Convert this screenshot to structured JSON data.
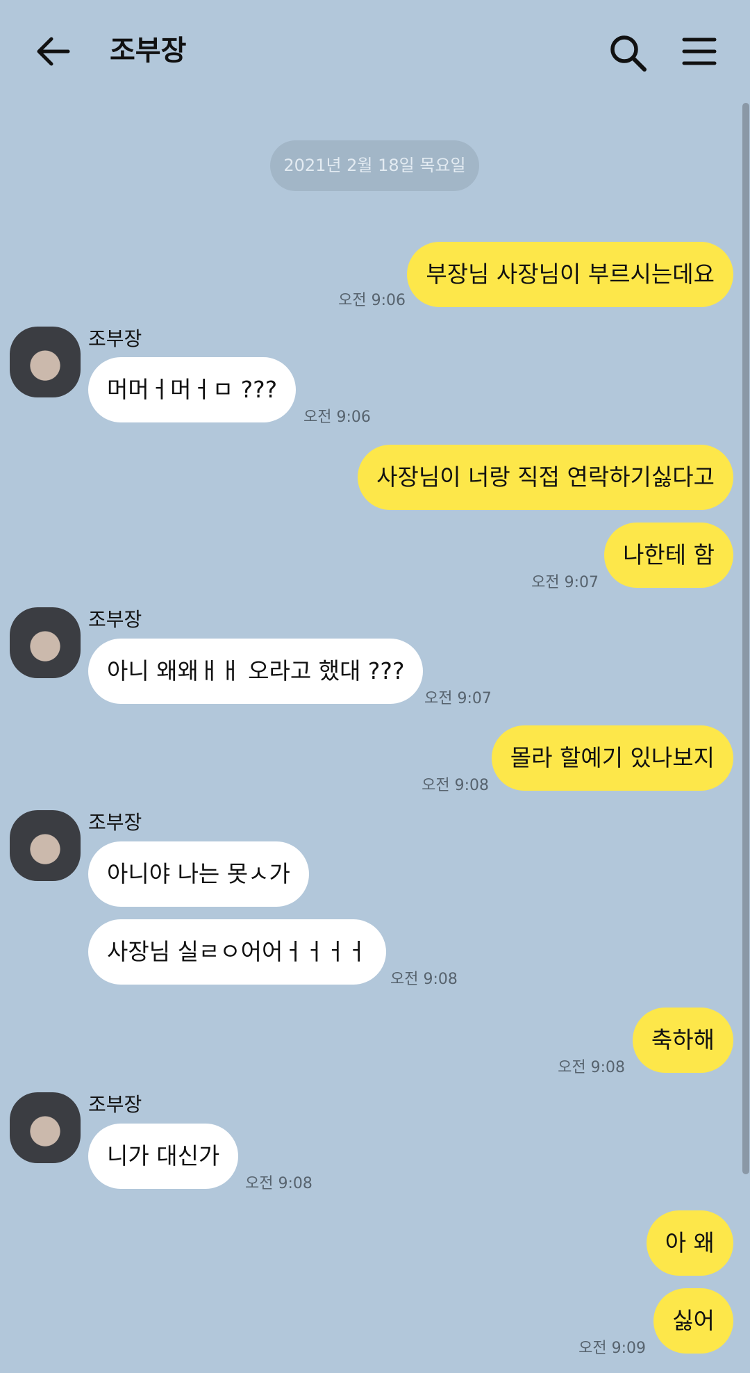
{
  "header": {
    "title": "조부장"
  },
  "date_separator": "2021년 2월 18일 목요일",
  "messages": {
    "m1": {
      "text": "부장님 사장님이 부르시는데요",
      "time": "오전 9:06"
    },
    "m2": {
      "sender": "조부장",
      "text": "머머ㅓ머ㅓㅁ ???",
      "time": "오전 9:06"
    },
    "m3": {
      "text": "사장님이 너랑 직접 연락하기싫다고"
    },
    "m4": {
      "text": "나한테 함",
      "time": "오전 9:07"
    },
    "m5": {
      "sender": "조부장",
      "text": "아니 왜왜ㅐㅐ 오라고 했대 ???",
      "time": "오전 9:07"
    },
    "m6": {
      "text": "몰라 할예기 있나보지",
      "time": "오전 9:08"
    },
    "m7": {
      "sender": "조부장",
      "text": "아니야 나는 못ㅅ가"
    },
    "m8": {
      "text": "사장님 실ㄹㅇ어어ㅓㅓㅓㅓ",
      "time": "오전 9:08"
    },
    "m9": {
      "text": "축하해",
      "time": "오전 9:08"
    },
    "m10": {
      "sender": "조부장",
      "text": "니가 대신가",
      "time": "오전 9:08"
    },
    "m11": {
      "text": "아 왜"
    },
    "m12": {
      "text": "싫어",
      "time": "오전 9:09"
    }
  }
}
